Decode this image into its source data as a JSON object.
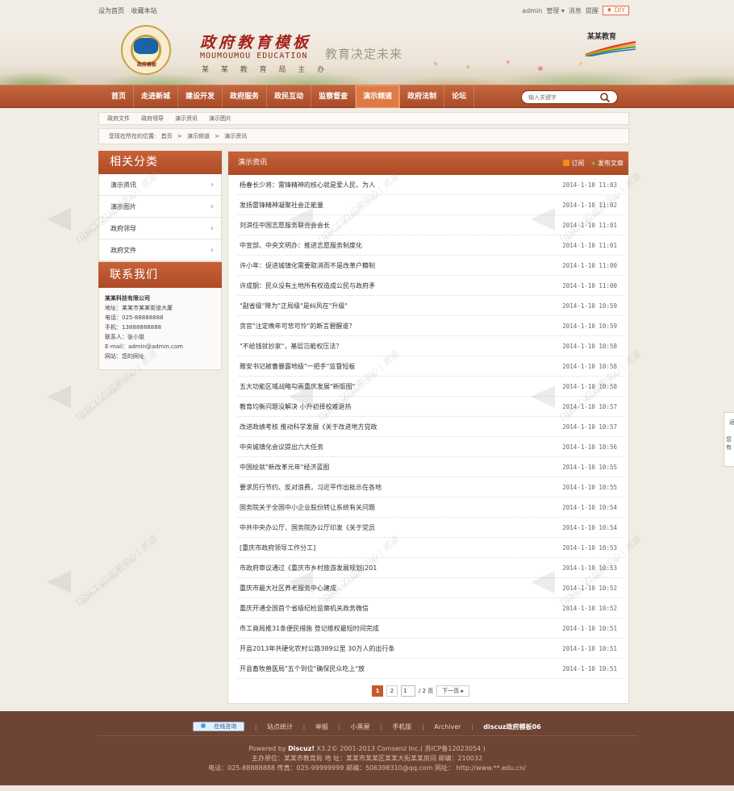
{
  "topbar": {
    "left": [
      "设为首页",
      "收藏本站"
    ],
    "right": {
      "user": "admin",
      "manage": "管理 ▾",
      "messages": "消息",
      "alerts": "提醒",
      "diy": "♦ DIY"
    }
  },
  "header": {
    "emblem_label": "政府模板",
    "brand_cn": "政府教育模板",
    "brand_en": "MOUMOUMOU  EDUCATION",
    "brand_sub": "某 某 教 育 局 主 办",
    "slogan": "教育决定未来",
    "right_logo": "某某教育"
  },
  "nav": {
    "items": [
      "首页",
      "走进新城",
      "建设开发",
      "政府服务",
      "政民互动",
      "监察督查",
      "演示频道",
      "政府法制",
      "论坛"
    ],
    "active_index": 6,
    "search_placeholder": "输入关键字"
  },
  "subnav": [
    "政府文件",
    "政府领导",
    "演示资讯",
    "演示图片"
  ],
  "breadcrumb": {
    "prefix": "您现在所在的位置:",
    "items": [
      "首页",
      "演示频道",
      "演示资讯"
    ],
    "sep": ">"
  },
  "sidebar": {
    "title": "相关分类",
    "items": [
      "演示资讯",
      "演示图片",
      "政府领导",
      "政府文件"
    ],
    "contact_title": "联系我们",
    "contact": {
      "company": "某某科技有限公司",
      "lines": [
        "地址：某某市某某街道大厦",
        "电话：025-88888888",
        "手机：13888888888",
        "联系人：张小姐",
        "E-mail：admin@admin.com",
        "网站：您的网址"
      ]
    }
  },
  "main": {
    "title": "演示资讯",
    "subscribe": "订阅",
    "publish": "发布文章",
    "news": [
      {
        "title": "杨春长少将：需锋精神的核心就是爱人民、为人",
        "date": "2014-1-10 11:03"
      },
      {
        "title": "发扬雷锋精神凝聚社会正能量",
        "date": "2014-1-10 11:02"
      },
      {
        "title": "刘淇任中国志愿服务联合会会长",
        "date": "2014-1-10 11:01"
      },
      {
        "title": "中宣部、中央文明办：推进志愿服务制度化",
        "date": "2014-1-10 11:01"
      },
      {
        "title": "许小年：促进城镇化需要取消而不是改革户籍制",
        "date": "2014-1-10 11:00"
      },
      {
        "title": "许成钢：民众没有土地所有权造成公民与政府矛",
        "date": "2014-1-10 11:00"
      },
      {
        "title": "\"副省级\"降为\"正局级\"是纠风在\"升级\"",
        "date": "2014-1-10 10:59"
      },
      {
        "title": "贪官\"注定晚年可悲可怜\"的断言碧醒谁？",
        "date": "2014-1-10 10:59"
      },
      {
        "title": "\"不给钱就抄家\"，基层岂能权压法？",
        "date": "2014-1-10 10:58"
      },
      {
        "title": "雅安书记被曹暴露地级\"一把手\"监督短板",
        "date": "2014-1-10 10:58"
      },
      {
        "title": "五大功能区域战略勾画重庆发展\"新版图\"",
        "date": "2014-1-10 10:58"
      },
      {
        "title": "教育均衡问题没解决 小升初择校难退热",
        "date": "2014-1-10 10:57"
      },
      {
        "title": "改进政绩考核 推动科学发展《关于改进地方党政",
        "date": "2014-1-10 10:57"
      },
      {
        "title": "中央城镇化会议提出六大任务",
        "date": "2014-1-10 10:56"
      },
      {
        "title": "中国绘就\"新改革元年\"经济蓝图",
        "date": "2014-1-10 10:55"
      },
      {
        "title": "要求厉行节约、反对浪费，习近平作出批示在各地",
        "date": "2014-1-10 10:55"
      },
      {
        "title": "国务院关于全国中小企业股份转让系统有关问题",
        "date": "2014-1-10 10:54"
      },
      {
        "title": "中共中央办公厅、国务院办公厅印发《关于党员",
        "date": "2014-1-10 10:54"
      },
      {
        "title": "[重庆市政府领导工作分工]",
        "date": "2014-1-10 10:53"
      },
      {
        "title": "市政府审议通过《重庆市乡村旅游发展规划(201",
        "date": "2014-1-10 10:53"
      },
      {
        "title": "重庆市最大社区养老服务中心建成",
        "date": "2014-1-10 10:52"
      },
      {
        "title": "重庆开通全国首个省级纪检监察机关政务微信",
        "date": "2014-1-10 10:52"
      },
      {
        "title": "市工商局推31条便民措施 登记维权最短时间完成",
        "date": "2014-1-10 10:51"
      },
      {
        "title": "开县2013年共硬化农村公路389公里 30万人的出行条",
        "date": "2014-1-10 10:51"
      },
      {
        "title": "开县畜牧兽医局\"五个到位\"确保民众吃上\"放",
        "date": "2014-1-10 10:51"
      }
    ],
    "pager": {
      "current": "1",
      "next_page": "2",
      "input": "1",
      "total": "/ 2 页",
      "next": "下一页 ▸"
    }
  },
  "float_tab": {
    "a": "返",
    "b": "您有"
  },
  "footer": {
    "online": "在线咨询",
    "links": [
      "站点统计",
      "举报",
      "小黑屋",
      "手机版",
      "Archiver",
      "discuz政府模板06"
    ],
    "powered_prefix": "Powered by ",
    "powered_brand": "Discuz!",
    "powered_rest": " X3.2© 2001-2013 Comsenz Inc.( 苏ICP备12023054 )",
    "line2": "主办单位：某某市教育局 地 址：某某市某某区某某大街某某房间 邮编：210032",
    "line3": "电话：025-88888888 传真：025-99999999 邮编：506398310@qq.com 网址： http://www.**.edu.cn/"
  },
  "watermark": {
    "text": "DISCUZ!应用中心 | 贰道",
    "sub": "addon.dismall.com"
  },
  "colors": {
    "brand_orange": "#c8623a",
    "nav": "#a94a28",
    "footer": "#6e4534",
    "title_red": "#a4211b"
  }
}
